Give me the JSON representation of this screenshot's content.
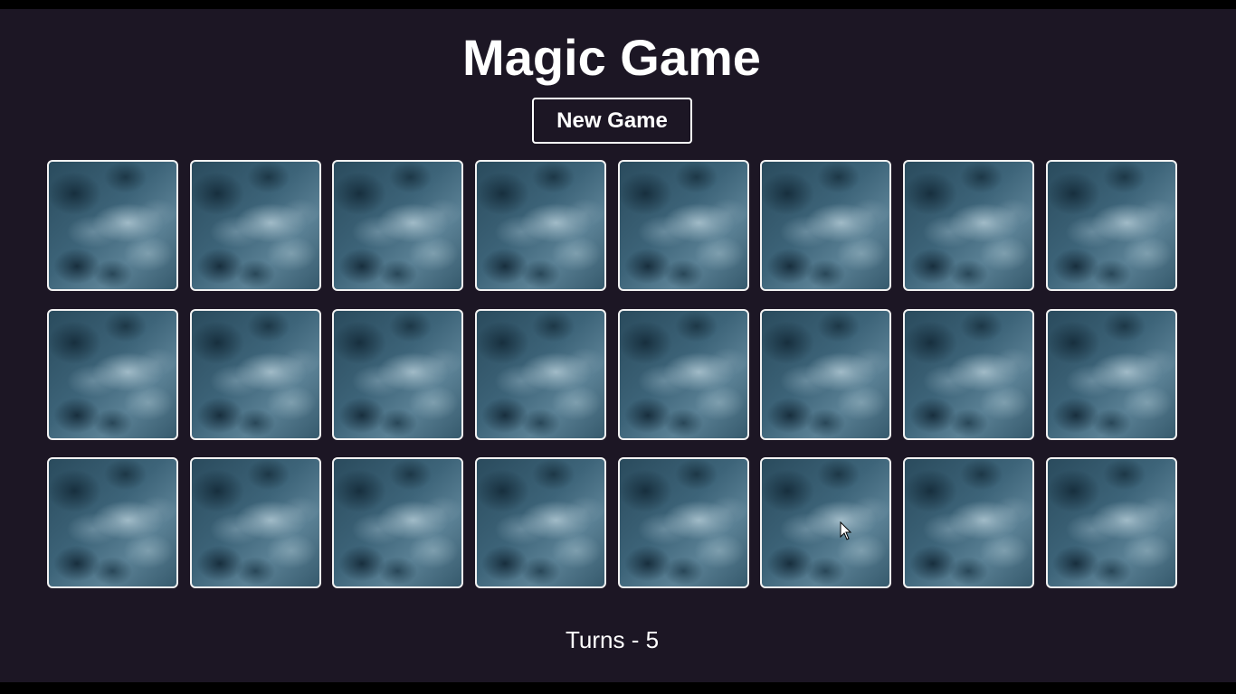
{
  "header": {
    "title": "Magic Game",
    "new_game_label": "New Game"
  },
  "board": {
    "rows": 3,
    "columns": 8,
    "cards": [
      {
        "face": "down"
      },
      {
        "face": "down"
      },
      {
        "face": "down"
      },
      {
        "face": "down"
      },
      {
        "face": "down"
      },
      {
        "face": "down"
      },
      {
        "face": "down"
      },
      {
        "face": "down"
      },
      {
        "face": "down"
      },
      {
        "face": "down"
      },
      {
        "face": "down"
      },
      {
        "face": "down"
      },
      {
        "face": "down"
      },
      {
        "face": "down"
      },
      {
        "face": "down"
      },
      {
        "face": "down"
      },
      {
        "face": "down"
      },
      {
        "face": "down"
      },
      {
        "face": "down"
      },
      {
        "face": "down"
      },
      {
        "face": "down"
      },
      {
        "face": "down"
      },
      {
        "face": "down"
      },
      {
        "face": "down"
      }
    ],
    "card_back": "cloudy-blue-texture"
  },
  "status": {
    "turns_text": "Turns - 5"
  },
  "colors": {
    "background": "#1c1624",
    "text": "#ffffff",
    "card_border": "#f2f2f2"
  }
}
